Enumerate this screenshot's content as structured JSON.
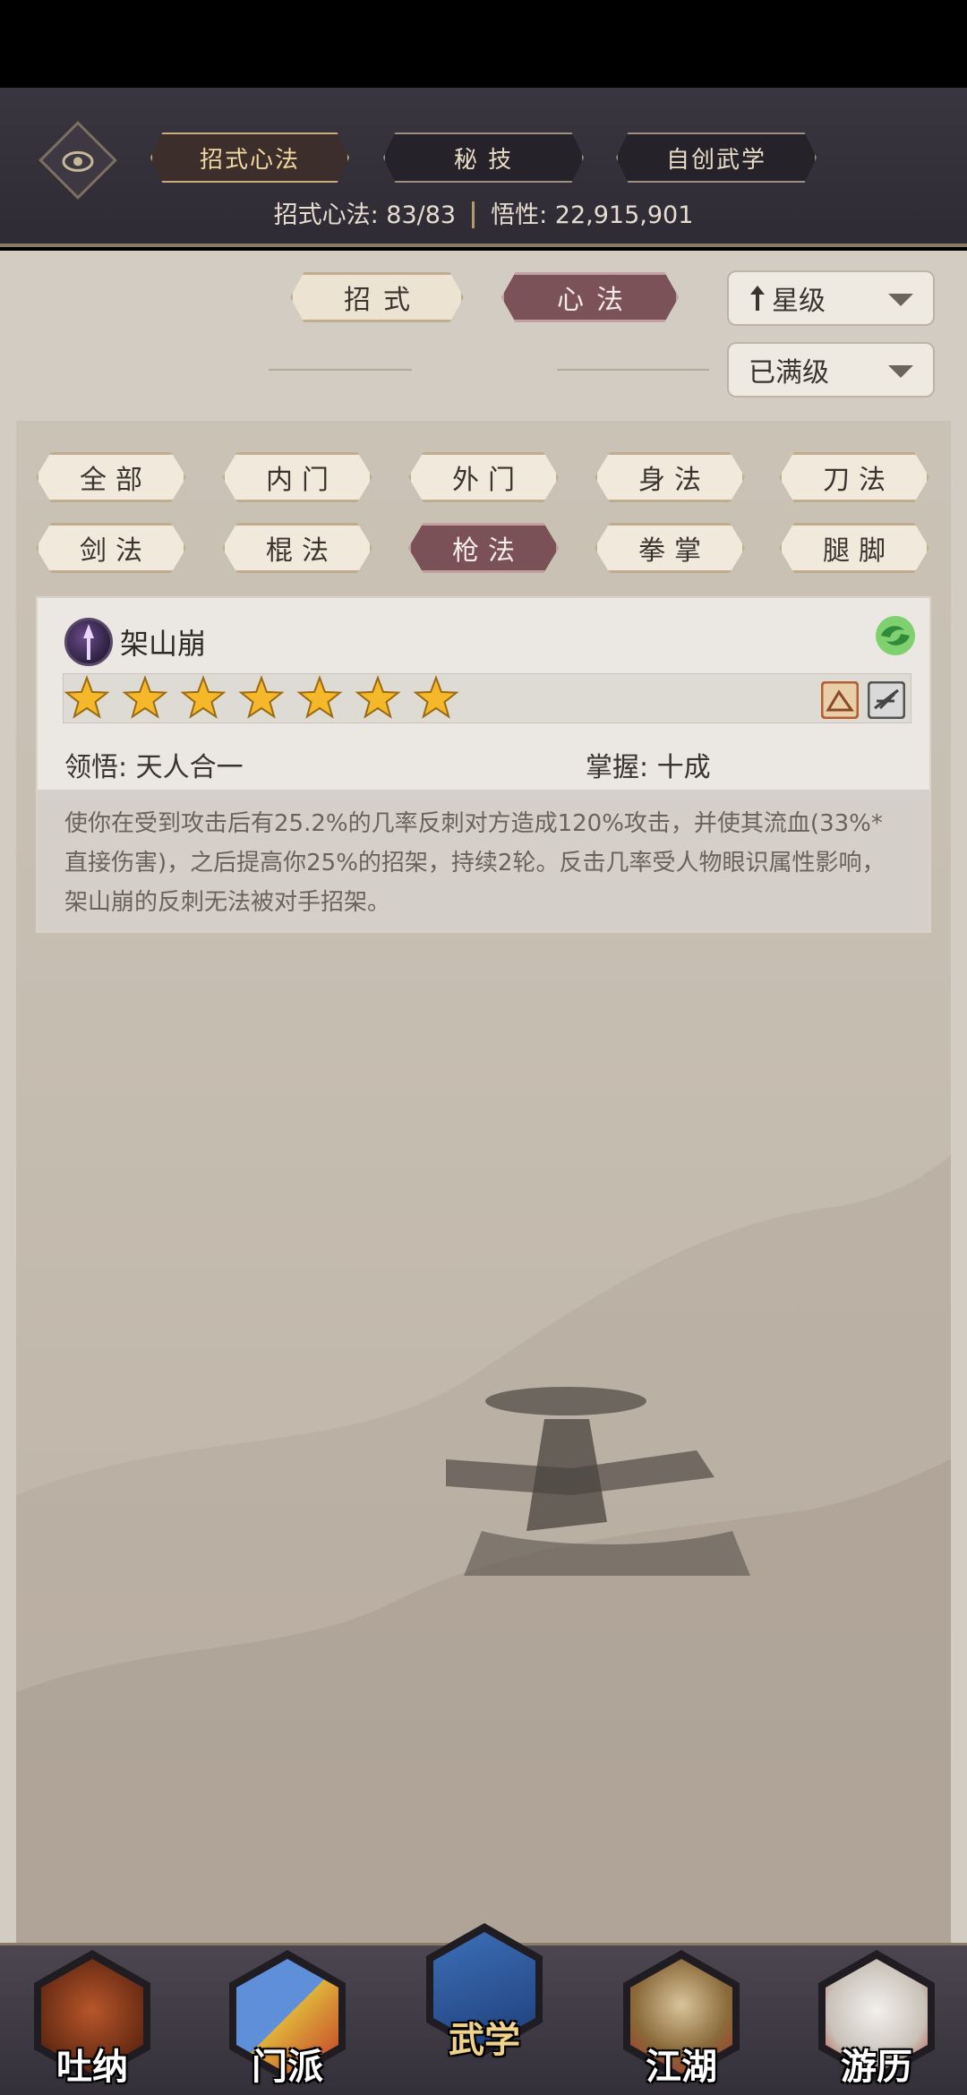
{
  "header": {
    "tabs": [
      {
        "label": "招式心法",
        "active": true
      },
      {
        "label": "秘 技",
        "active": false
      },
      {
        "label": "自创武学",
        "active": false
      }
    ],
    "summary_label_1": "招式心法: 83/83",
    "summary_label_2": "悟性: 22,915,901"
  },
  "mode_tabs": [
    {
      "label": "招式",
      "active": false
    },
    {
      "label": "心法",
      "active": true
    }
  ],
  "sort": {
    "order_label": "星级",
    "filter_label": "已满级"
  },
  "categories": [
    {
      "label": "全部",
      "active": false
    },
    {
      "label": "内门",
      "active": false
    },
    {
      "label": "外门",
      "active": false
    },
    {
      "label": "身法",
      "active": false
    },
    {
      "label": "刀法",
      "active": false
    },
    {
      "label": "剑法",
      "active": false
    },
    {
      "label": "棍法",
      "active": false
    },
    {
      "label": "枪法",
      "active": true
    },
    {
      "label": "拳掌",
      "active": false
    },
    {
      "label": "腿脚",
      "active": false
    }
  ],
  "skill": {
    "name": "架山崩",
    "stars": 7,
    "comprehension": "领悟: 天人合一",
    "mastery": "掌握: 十成",
    "description": "使你在受到攻击后有25.2%的几率反刺对方造成120%攻击，并使其流血(33%*直接伤害)，之后提高你25%的招架，持续2轮。反击几率受人物眼识属性影响，架山崩的反刺无法被对手招架。"
  },
  "bottom_nav": [
    {
      "label": "吐纳",
      "active": false
    },
    {
      "label": "门派",
      "active": false
    },
    {
      "label": "武学",
      "active": true
    },
    {
      "label": "江湖",
      "active": false
    },
    {
      "label": "游历",
      "active": false
    }
  ],
  "colors": {
    "header_bg": "#2f2b35",
    "content_bg": "#d2ccc3",
    "active_pill": "#7c5259",
    "gold": "#f0d8a2"
  }
}
